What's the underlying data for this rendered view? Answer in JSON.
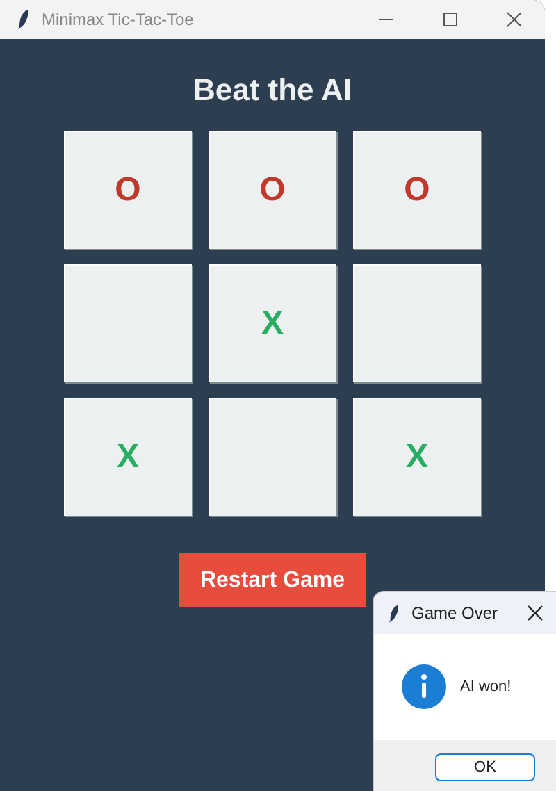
{
  "window": {
    "title": "Minimax Tic-Tac-Toe"
  },
  "heading": "Beat the AI",
  "board": [
    {
      "kind": "filled",
      "mark": "O",
      "color": "#c0392b"
    },
    {
      "kind": "filled",
      "mark": "O",
      "color": "#c0392b"
    },
    {
      "kind": "filled",
      "mark": "O",
      "color": "#c0392b"
    },
    {
      "kind": "empty"
    },
    {
      "kind": "filled",
      "mark": "X",
      "color": "#27ae60"
    },
    {
      "kind": "empty"
    },
    {
      "kind": "filled",
      "mark": "X",
      "color": "#27ae60"
    },
    {
      "kind": "empty"
    },
    {
      "kind": "filled",
      "mark": "X",
      "color": "#27ae60"
    }
  ],
  "restart_button": "Restart Game",
  "dialog": {
    "title": "Game Over",
    "message": "AI won!",
    "button": "OK"
  }
}
